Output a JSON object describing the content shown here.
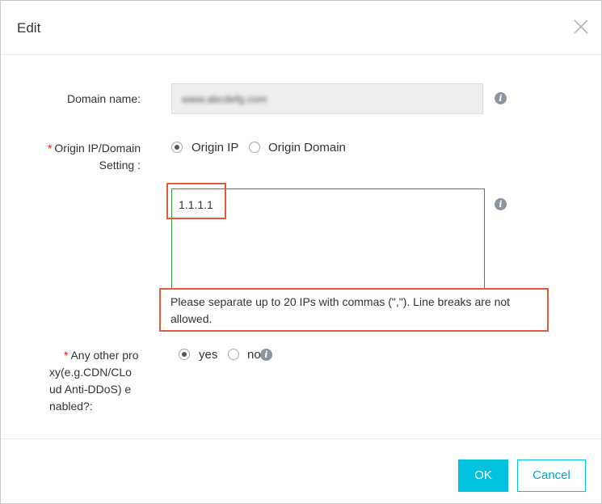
{
  "dialog": {
    "title": "Edit",
    "close_icon": "close-icon"
  },
  "form": {
    "domain_label": "Domain name:",
    "domain_value": "www.abcdefg.com",
    "origin_required": "*",
    "origin_label_line1": "Origin IP/Domain",
    "origin_label_line2": "Setting :",
    "origin_options": [
      {
        "label": "Origin IP",
        "checked": true
      },
      {
        "label": "Origin Domain",
        "checked": false
      }
    ],
    "ip_value": "1.1.1.1",
    "ip_tip": "Please separate up to 20 IPs with commas (\",\"). Line breaks are not allowed.",
    "proxy_required": "*",
    "proxy_label_line1": "Any other pro",
    "proxy_label_line2": "xy(e.g.CDN/CLo",
    "proxy_label_line3": "ud Anti-DDoS) e",
    "proxy_label_line4": "nabled?:",
    "proxy_options": [
      {
        "label": "yes",
        "checked": true
      },
      {
        "label": "no",
        "checked": false
      }
    ],
    "info_glyph": "i"
  },
  "footer": {
    "ok_label": "OK",
    "cancel_label": "Cancel"
  },
  "colors": {
    "primary": "#00c1de",
    "highlight": "#e05a3c",
    "required": "#e2231a",
    "focus_border": "#2e9a3e"
  }
}
